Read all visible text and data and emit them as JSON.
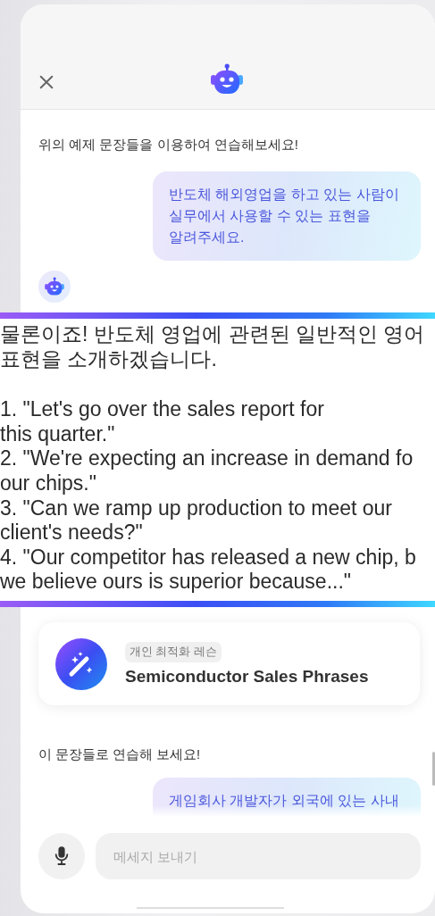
{
  "chat_top": [
    {
      "kind": "bot",
      "text": "위의 예제 문장들을 이용하여 연습해보세요!"
    },
    {
      "kind": "user",
      "text": "반도체 해외영업을 하고 있는 사람이 실무에서 사용할 수 있는 표현을 알려주세요."
    },
    {
      "kind": "avatar"
    }
  ],
  "magnified_reply": {
    "paragraphs": [
      {
        "lines": [
          "물론이죠! 반도체 영업에 관련된 일반적인 영어",
          "표현을 소개하겠습니다."
        ]
      },
      {
        "lines": [
          "1. \"Let's go over the sales report for",
          "this quarter.\"",
          "2. \"We're expecting an increase in demand fo",
          "our chips.\"",
          "3. \"Can we ramp up production to meet our",
          "client's needs?\"",
          "4. \"Our competitor has released a new chip, b",
          "we believe ours is superior because...\""
        ]
      }
    ]
  },
  "lesson_card": {
    "tag": "개인 최적화 레슨",
    "title": "Semiconductor Sales Phrases"
  },
  "chat_bottom": [
    {
      "kind": "bot",
      "text": "이 문장들로 연습해 보세요!"
    },
    {
      "kind": "user",
      "text": "게임회사 개발자가 외국에 있는 사내",
      "cut": true
    }
  ],
  "composer": {
    "placeholder": "메세지 보내기"
  }
}
